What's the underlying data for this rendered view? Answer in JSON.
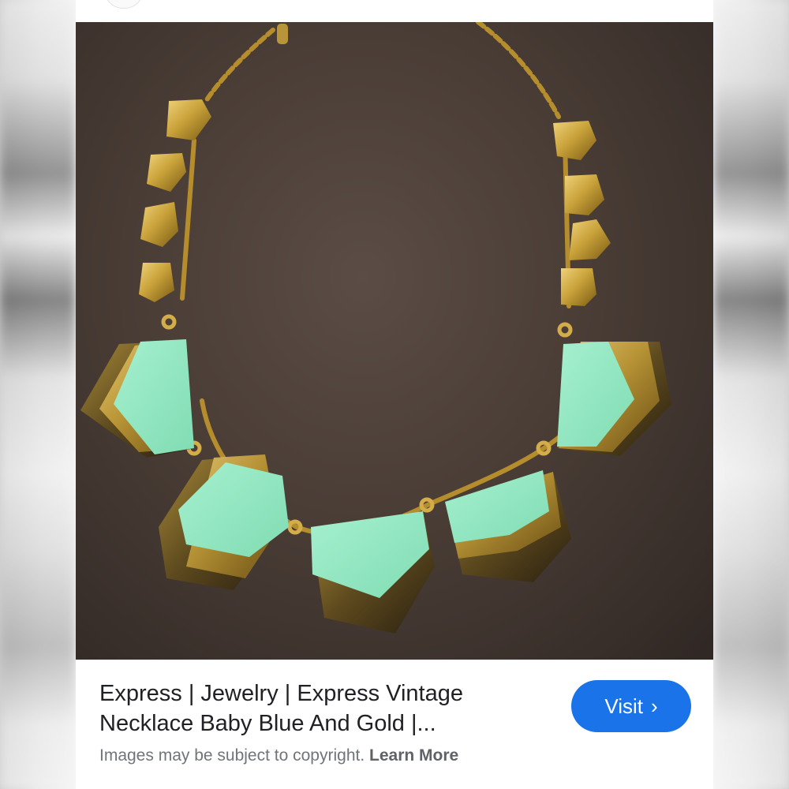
{
  "result": {
    "title_line1": "Express | Jewelry | Express Vintage",
    "title_line2": "Necklace Baby Blue And Gold |...",
    "visit_label": "Visit",
    "visit_icon": "chevron-right-icon",
    "copyright_text": "Images may be subject to copyright.",
    "learn_more_label": "Learn More"
  },
  "colors": {
    "accent": "#1a73e8",
    "gold": "#c9a23a",
    "mint": "#8ee6bf",
    "background": "#4a3d36"
  },
  "image": {
    "subject": "gold chain necklace with mint green and gold pentagon pendants"
  }
}
